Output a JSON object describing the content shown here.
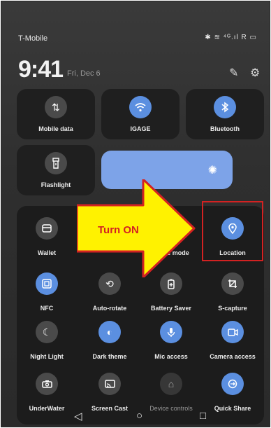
{
  "status": {
    "carrier": "T-Mobile",
    "icons": "✱ ≋ ⁴ᴳ.ıl R ▭"
  },
  "header": {
    "time": "9:41",
    "date": "Fri, Dec 6"
  },
  "top_tiles": [
    {
      "label": "Mobile data",
      "icon": "↿⇂"
    },
    {
      "label": "IGAGE",
      "icon": "wifi"
    },
    {
      "label": "Bluetooth",
      "icon": "bluetooth"
    }
  ],
  "flashlight": {
    "label": "Flashlight"
  },
  "grid": [
    {
      "label": "Wallet"
    },
    {
      "label": "c mode"
    },
    {
      "label": "Location"
    },
    {
      "label": "NFC"
    },
    {
      "label": "Auto-rotate"
    },
    {
      "label": "Battery Saver"
    },
    {
      "label": "S-capture"
    },
    {
      "label": "Night Light"
    },
    {
      "label": "Dark theme"
    },
    {
      "label": "Mic access"
    },
    {
      "label": "Camera access"
    },
    {
      "label": "UnderWater"
    },
    {
      "label": "Screen Cast"
    },
    {
      "label": "Device controls"
    },
    {
      "label": "Quick Share"
    }
  ],
  "annotation": {
    "text": "Turn ON"
  },
  "colors": {
    "accent": "#5b8fe0",
    "annotation_fill": "#fff200",
    "annotation_border": "#d32222"
  }
}
